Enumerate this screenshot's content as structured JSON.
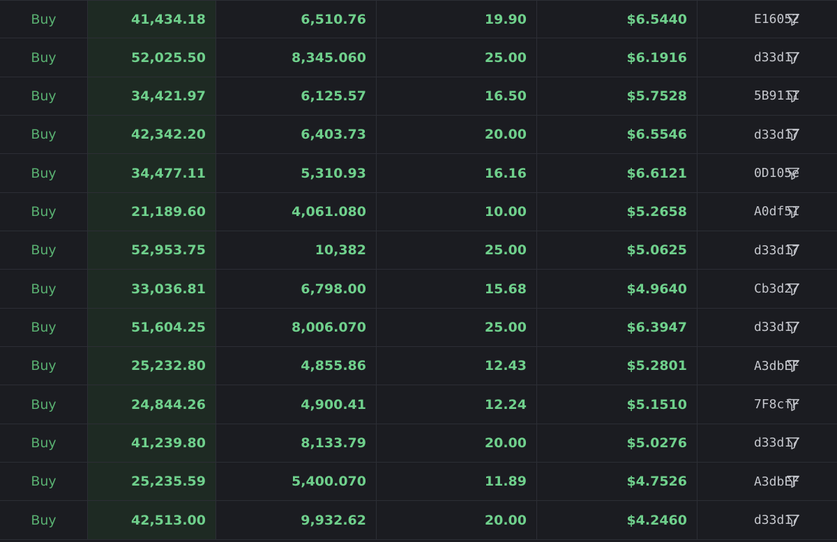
{
  "colors": {
    "background": "#1b1c21",
    "buy_green": "#6fd08c",
    "side_green": "#59b071",
    "usd_column_bg": "#1e2a23",
    "maker_text": "#c4c6cc",
    "grid_line": "#2c2e35"
  },
  "icons": {
    "maker_filter": "filter-icon"
  },
  "trades": [
    {
      "side": "Buy",
      "usd": "41,434.18",
      "tokens": "6,510.76",
      "sol": "19.90",
      "price": "$6.5440",
      "maker": "E16052"
    },
    {
      "side": "Buy",
      "usd": "52,025.50",
      "tokens": "8,345.060",
      "sol": "25.00",
      "price": "$6.1916",
      "maker": "d33d17"
    },
    {
      "side": "Buy",
      "usd": "34,421.97",
      "tokens": "6,125.57",
      "sol": "16.50",
      "price": "$5.7528",
      "maker": "5B9111"
    },
    {
      "side": "Buy",
      "usd": "42,342.20",
      "tokens": "6,403.73",
      "sol": "20.00",
      "price": "$6.5546",
      "maker": "d33d17"
    },
    {
      "side": "Buy",
      "usd": "34,477.11",
      "tokens": "5,310.93",
      "sol": "16.16",
      "price": "$6.6121",
      "maker": "0D105e"
    },
    {
      "side": "Buy",
      "usd": "21,189.60",
      "tokens": "4,061.080",
      "sol": "10.00",
      "price": "$5.2658",
      "maker": "A0df51"
    },
    {
      "side": "Buy",
      "usd": "52,953.75",
      "tokens": "10,382",
      "sol": "25.00",
      "price": "$5.0625",
      "maker": "d33d17"
    },
    {
      "side": "Buy",
      "usd": "33,036.81",
      "tokens": "6,798.00",
      "sol": "15.68",
      "price": "$4.9640",
      "maker": "Cb3d27"
    },
    {
      "side": "Buy",
      "usd": "51,604.25",
      "tokens": "8,006.070",
      "sol": "25.00",
      "price": "$6.3947",
      "maker": "d33d17"
    },
    {
      "side": "Buy",
      "usd": "25,232.80",
      "tokens": "4,855.86",
      "sol": "12.43",
      "price": "$5.2801",
      "maker": "A3dbEF"
    },
    {
      "side": "Buy",
      "usd": "24,844.26",
      "tokens": "4,900.41",
      "sol": "12.24",
      "price": "$5.1510",
      "maker": "7F8cfF"
    },
    {
      "side": "Buy",
      "usd": "41,239.80",
      "tokens": "8,133.79",
      "sol": "20.00",
      "price": "$5.0276",
      "maker": "d33d17"
    },
    {
      "side": "Buy",
      "usd": "25,235.59",
      "tokens": "5,400.070",
      "sol": "11.89",
      "price": "$4.7526",
      "maker": "A3dbEF"
    },
    {
      "side": "Buy",
      "usd": "42,513.00",
      "tokens": "9,932.62",
      "sol": "20.00",
      "price": "$4.2460",
      "maker": "d33d17"
    }
  ]
}
